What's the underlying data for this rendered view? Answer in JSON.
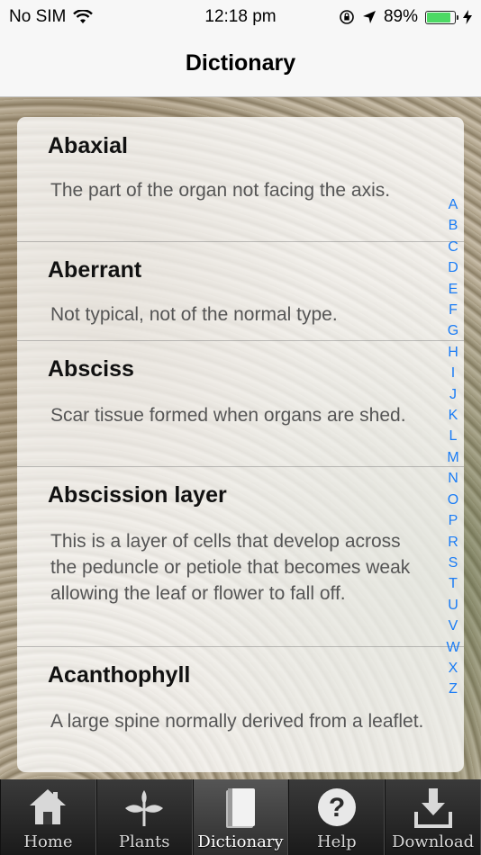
{
  "status_bar": {
    "carrier": "No SIM",
    "time": "12:18 pm",
    "battery_percent": "89%",
    "battery_level": 0.89,
    "battery_color": "#4cd964",
    "icons": [
      "wifi-icon",
      "lock-rotation-icon",
      "location-icon",
      "battery-icon",
      "charging-icon"
    ]
  },
  "nav": {
    "title": "Dictionary"
  },
  "entries": [
    {
      "term": "Abaxial",
      "definition": "The part of the organ not facing the axis."
    },
    {
      "term": "Aberrant",
      "definition": "Not typical, not of the normal type."
    },
    {
      "term": "Absciss",
      "definition": "Scar tissue formed when organs are shed."
    },
    {
      "term": "Abscission layer",
      "definition": "This is a layer of cells that develop across the peduncle or petiole that becomes weak allowing the leaf or flower to fall off."
    },
    {
      "term": "Acanthophyll",
      "definition": "A large spine normally derived from a leaflet."
    }
  ],
  "index": [
    "A",
    "B",
    "C",
    "D",
    "E",
    "F",
    "G",
    "H",
    "I",
    "J",
    "K",
    "L",
    "M",
    "N",
    "O",
    "P",
    "R",
    "S",
    "T",
    "U",
    "V",
    "W",
    "X",
    "Z"
  ],
  "index_color": "#1a7cf5",
  "tabs": [
    {
      "label": "Home",
      "icon": "home-icon",
      "active": false
    },
    {
      "label": "Plants",
      "icon": "plant-icon",
      "active": false
    },
    {
      "label": "Dictionary",
      "icon": "book-icon",
      "active": true
    },
    {
      "label": "Help",
      "icon": "help-icon",
      "active": false
    },
    {
      "label": "Download",
      "icon": "download-icon",
      "active": false
    }
  ]
}
